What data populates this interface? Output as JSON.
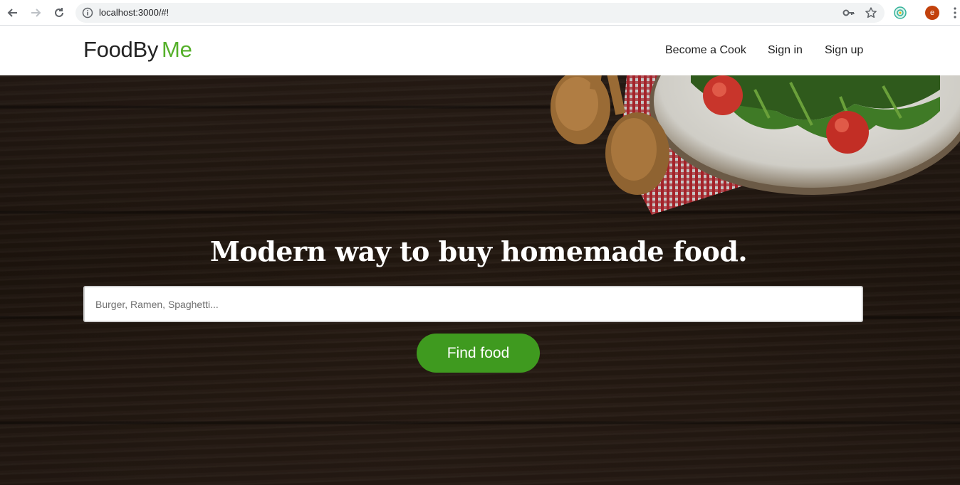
{
  "browser": {
    "url": "localhost:3000/#!",
    "profile_initial": "e",
    "icons": [
      "back-arrow-icon",
      "forward-arrow-icon",
      "reload-icon",
      "info-icon",
      "key-icon",
      "star-icon",
      "extension-icon",
      "kebab-menu-icon"
    ]
  },
  "header": {
    "logo_part1": "FoodBy",
    "logo_part2": "Me",
    "nav": {
      "become_cook": "Become a Cook",
      "sign_in": "Sign in",
      "sign_up": "Sign up"
    }
  },
  "hero": {
    "title": "Modern way to buy homemade food.",
    "search_placeholder": "Burger, Ramen, Spaghetti...",
    "search_value": "",
    "button_label": "Find food"
  },
  "colors": {
    "brand_green": "#55b02a",
    "button_green": "#3f9a1f",
    "hero_wood": "#2a1d14",
    "text_dark": "#222222"
  }
}
